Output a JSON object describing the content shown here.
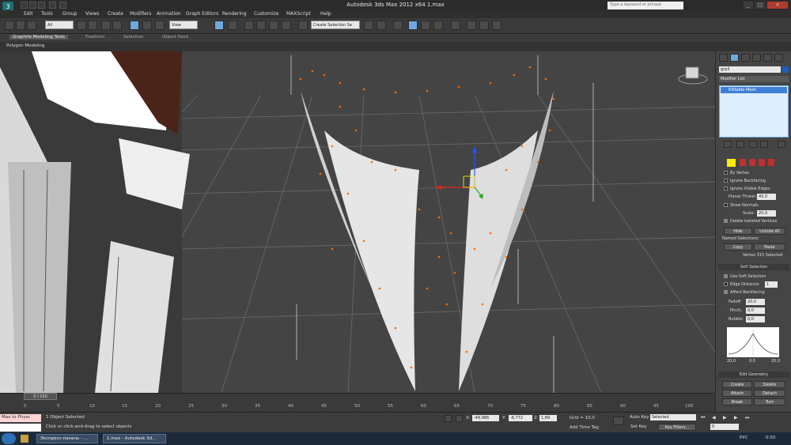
{
  "window": {
    "title": "Autodesk 3ds Max  2012 x64      1.max",
    "logo": "3"
  },
  "search": {
    "placeholder": "Type a keyword or phrase"
  },
  "menu": [
    "Edit",
    "Tools",
    "Group",
    "Views",
    "Create",
    "Modifiers",
    "Animation",
    "Graph Editors",
    "Rendering",
    "Customize",
    "MAXScript",
    "Help"
  ],
  "toolbar": {
    "selection_filter": "All",
    "ref_coord": "View",
    "named_selection": "Create Selection Se"
  },
  "ribbon": {
    "tabs": [
      "Graphite Modeling Tools",
      "Freeform",
      "Selection",
      "Object Paint"
    ],
    "sub": "Polygon Modeling"
  },
  "command_panel": {
    "object_name": "grp3",
    "modifier_list": "Modifier List",
    "stack_item": "Editable Mesh",
    "selection": {
      "by_vertex": "By Vertex",
      "ignore_backfacing": "Ignore Backfacing",
      "ignore_visible_edges": "Ignore Visible Edges",
      "planar_thresh_label": "Planar Thresh:",
      "planar_thresh_value": "45,0",
      "show_normals": "Show Normals",
      "scale_label": "Scale:",
      "scale_value": "20,0",
      "delete_isolated": "Delete Isolated Vertices",
      "hide": "Hide",
      "unhide_all": "Unhide All",
      "named_selections": "Named Selections:",
      "copy": "Copy",
      "paste": "Paste",
      "status": "Vertex 315 Selected"
    },
    "soft_selection": {
      "title": "Soft Selection",
      "use_soft": "Use Soft Selection",
      "edge_distance": "Edge Distance:",
      "edge_distance_value": "1",
      "affect_backfacing": "Affect Backfacing",
      "falloff_label": "Falloff:",
      "falloff_value": "20,0",
      "pinch_label": "Pinch:",
      "pinch_value": "0,0",
      "bubble_label": "Bubble:",
      "bubble_value": "0,0",
      "curve_left": "20,0",
      "curve_mid": "0,0",
      "curve_right": "20,0"
    },
    "edit_geometry": {
      "title": "Edit Geometry",
      "create": "Create",
      "delete": "Delete",
      "attach": "Attach",
      "detach": "Detach",
      "break": "Break",
      "turn": "Turn"
    }
  },
  "timeline": {
    "slider": "0 / 100",
    "ticks": [
      "0",
      "5",
      "10",
      "15",
      "20",
      "25",
      "30",
      "35",
      "40",
      "45",
      "50",
      "55",
      "60",
      "65",
      "70",
      "75",
      "80",
      "85",
      "90",
      "95",
      "100"
    ]
  },
  "status": {
    "maxscript": "Max to Physc",
    "selected": "1 Object Selected",
    "prompt": "Click or click-and-drag to select objects",
    "x_label": "X:",
    "x": "-49,986",
    "y_label": "Y:",
    "y": "-6,772",
    "z_label": "Z:",
    "z": "1,89",
    "grid": "Grid = 10,0",
    "add_time_tag": "Add Time Tag",
    "auto_key": "Auto Key",
    "selected_dd": "Selected",
    "set_key": "Set Key",
    "key_filters": "Key Filters...",
    "frame": "0"
  },
  "taskbar": {
    "tasks": [
      "Экспресс-панель - ...",
      "1.max - Autodesk 3d..."
    ],
    "lang": "РУС",
    "time": "0:50"
  },
  "colors": {
    "accent": "#6fa8dc",
    "vertex": "#ff6a00",
    "viewport_bg": "#444444"
  }
}
